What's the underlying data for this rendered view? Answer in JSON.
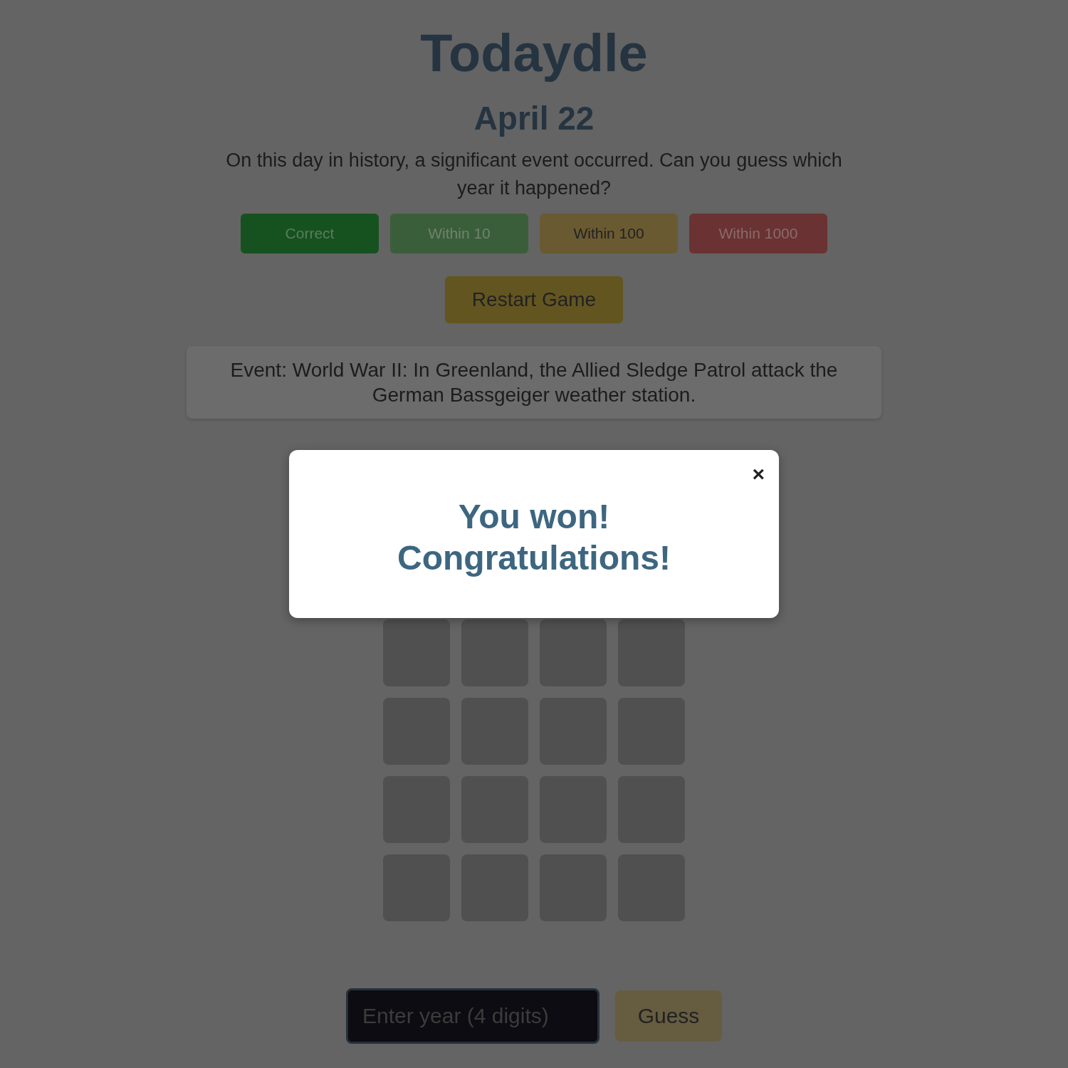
{
  "title": "Todaydle",
  "date": "April 22",
  "intro": "On this day in history, a significant event occurred. Can you guess which year it happened?",
  "legend": [
    {
      "label": "Correct",
      "color": "#16521f"
    },
    {
      "label": "Within 10",
      "color": "#3a5e3a"
    },
    {
      "label": "Within 100",
      "color": "#6a5a32"
    },
    {
      "label": "Within 1000",
      "color": "#6a3232"
    }
  ],
  "restart_button": "Restart Game",
  "event": "Event: World War II: In Greenland, the Allied Sledge Patrol attack the German Bassgeiger weather station.",
  "board": [
    [
      {
        "filled": false
      },
      {
        "filled": false
      },
      {
        "filled": false
      },
      {
        "filled": false
      }
    ],
    [
      {
        "filled": false
      },
      {
        "filled": false
      },
      {
        "filled": false
      },
      {
        "filled": false
      }
    ],
    [
      {
        "filled": false
      },
      {
        "filled": false
      },
      {
        "filled": false
      },
      {
        "filled": false
      }
    ],
    [
      {
        "filled": false
      },
      {
        "filled": false
      },
      {
        "filled": false
      },
      {
        "filled": false
      }
    ]
  ],
  "year_field": {
    "placeholder": "Enter year (4 digits)"
  },
  "guess_button": "Guess",
  "modal": {
    "close": "×",
    "message": "You won! Congratulations!"
  }
}
